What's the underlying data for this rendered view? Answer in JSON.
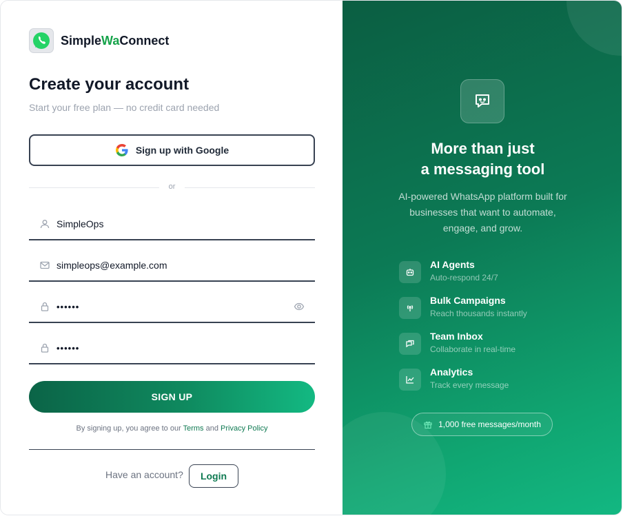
{
  "brand": {
    "name_part1": "Simple",
    "name_accent": "Wa",
    "name_part2": "Connect",
    "logo_icon": "whatsapp-icon"
  },
  "form": {
    "title": "Create your account",
    "subtitle": "Start your free plan — no credit card needed",
    "google_button": "Sign up with Google",
    "divider": "or",
    "fields": {
      "name": {
        "value": "SimpleOps",
        "icon": "user-icon"
      },
      "email": {
        "value": "simpleops@example.com",
        "icon": "mail-icon"
      },
      "password": {
        "value": "••••••",
        "icon": "lock-icon"
      },
      "confirm_password": {
        "value": "••••••",
        "icon": "lock-icon"
      }
    },
    "submit": "SIGN UP",
    "terms_prefix": "By signing up, you agree to our ",
    "terms_link": "Terms",
    "terms_and": " and ",
    "privacy_link": "Privacy Policy",
    "have_account": "Have an account?",
    "login": "Login"
  },
  "promo": {
    "headline_line1": "More than just",
    "headline_line2": "a messaging tool",
    "description": "AI-powered WhatsApp platform built for businesses that want to automate, engage, and grow.",
    "features": [
      {
        "title": "AI Agents",
        "subtitle": "Auto-respond 24/7",
        "icon": "robot-icon"
      },
      {
        "title": "Bulk Campaigns",
        "subtitle": "Reach thousands instantly",
        "icon": "broadcast-icon"
      },
      {
        "title": "Team Inbox",
        "subtitle": "Collaborate in real-time",
        "icon": "chat-icon"
      },
      {
        "title": "Analytics",
        "subtitle": "Track every message",
        "icon": "chart-icon"
      }
    ],
    "badge": "1,000 free messages/month"
  },
  "colors": {
    "accent": "#0f7a52",
    "brand_green": "#16a34a",
    "gradient_start": "#0b5e42",
    "gradient_end": "#13b882"
  }
}
